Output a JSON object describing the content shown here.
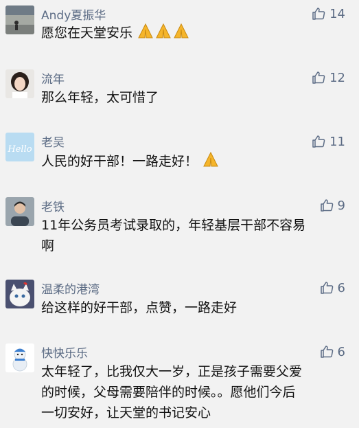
{
  "comments": [
    {
      "author": "Andy夏振华",
      "content": "愿您在天堂安乐",
      "emoji_count": 3,
      "likes": "14"
    },
    {
      "author": "流年",
      "content": "那么年轻，太可惜了",
      "emoji_count": 0,
      "likes": "12"
    },
    {
      "author": "老吴",
      "content": "人民的好干部！一路走好！",
      "emoji_count": 1,
      "likes": "11"
    },
    {
      "author": "老铁",
      "content_lines": [
        "11年公务员考试录取的，年轻基层干部不容易",
        "啊"
      ],
      "likes": "9"
    },
    {
      "author": "温柔的港湾",
      "content": "给这样的好干部，点赞，一路走好",
      "likes": "6"
    },
    {
      "author": "快快乐乐",
      "content_lines": [
        "太年轻了，比我仅大一岁，正是孩子需要父爱",
        "的时候，父母需要陪伴的时候。。愿他们今后",
        "一切安好，让天堂的书记安心"
      ],
      "likes": "6"
    }
  ],
  "icons": {
    "like": "thumbs-up-icon",
    "emoji": "folded-hands-emoji"
  },
  "avatar_labels": {
    "c3": "Hello"
  },
  "colors": {
    "meta": "#5b6b84",
    "text": "#111111",
    "background": "#f2f2f2"
  }
}
